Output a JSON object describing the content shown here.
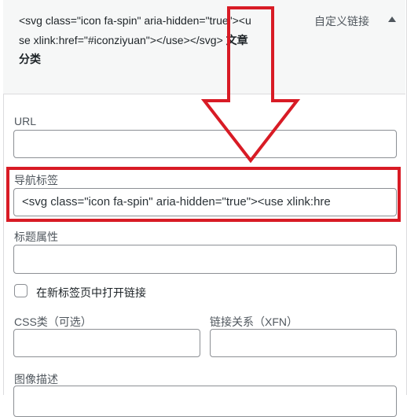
{
  "menu_item": {
    "title_code": "<svg class=\"icon fa-spin\" aria-hidden=\"true\"><use xlink:href=\"#iconziyuan\"></use></svg>",
    "title_text": "文章分类",
    "type_label": "自定义链接"
  },
  "fields": {
    "url_label": "URL",
    "url_value": "",
    "nav_label_label": "导航标签",
    "nav_label_value": "<svg class=\"icon fa-spin\" aria-hidden=\"true\"><use xlink:hre",
    "title_attr_label": "标题属性",
    "title_attr_value": "",
    "new_tab_label": "在新标签页中打开链接",
    "css_label": "CSS类（可选）",
    "css_value": "",
    "xfn_label": "链接关系（XFN）",
    "xfn_value": "",
    "desc_label": "图像描述",
    "desc_value": ""
  },
  "annotation": {
    "arrow_color": "#d81b25",
    "highlight_color": "#d81b25"
  }
}
